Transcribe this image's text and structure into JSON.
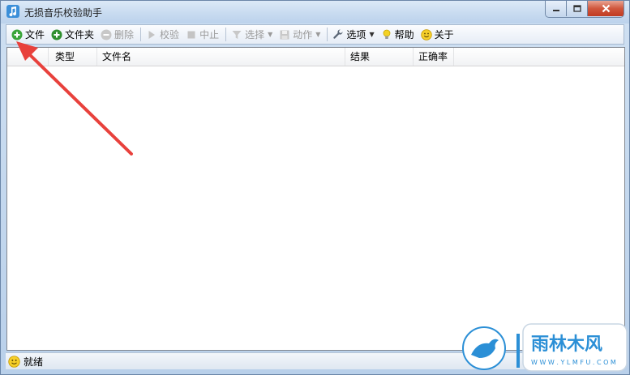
{
  "window": {
    "title": "无损音乐校验助手",
    "title_icon": "music-note-icon"
  },
  "toolbar": {
    "items": [
      {
        "label": "文件",
        "icon": "add-green-icon",
        "enabled": true
      },
      {
        "label": "文件夹",
        "icon": "add-folder-icon",
        "enabled": true
      },
      {
        "label": "删除",
        "icon": "delete-icon",
        "enabled": false
      },
      {
        "label": "校验",
        "icon": "play-icon",
        "enabled": false
      },
      {
        "label": "中止",
        "icon": "stop-icon",
        "enabled": false
      },
      {
        "label": "选择",
        "icon": "filter-icon",
        "enabled": false
      },
      {
        "label": "动作",
        "icon": "save-icon",
        "enabled": false
      },
      {
        "label": "选项",
        "icon": "wrench-icon",
        "enabled": true
      },
      {
        "label": "帮助",
        "icon": "lightbulb-icon",
        "enabled": true
      },
      {
        "label": "关于",
        "icon": "smiley-icon",
        "enabled": true
      }
    ]
  },
  "list": {
    "columns": [
      "类型",
      "文件名",
      "结果",
      "正确率"
    ],
    "rows": []
  },
  "status": {
    "text": "就绪",
    "icon": "smiley-icon"
  },
  "watermark": {
    "text": "雨林木风",
    "url_text": "W W W . Y L M F U . C O M"
  },
  "colors": {
    "accent_green": "#3aa53a",
    "arrow_red": "#e8413c",
    "close_red": "#c9462c"
  }
}
